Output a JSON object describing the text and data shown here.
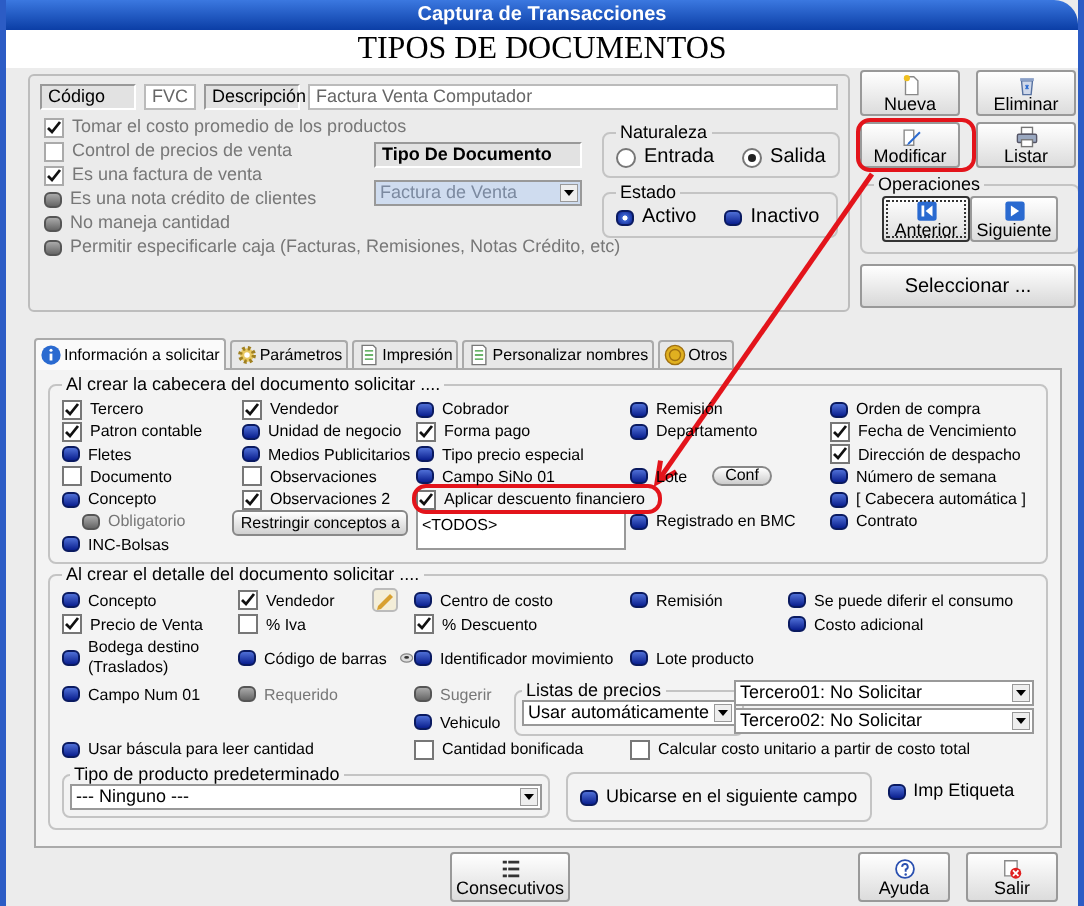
{
  "window": {
    "title": "Captura de Transacciones"
  },
  "heading": "TIPOS DE DOCUMENTOS",
  "general": {
    "code": {
      "label": "Código",
      "value": "FVC"
    },
    "description": {
      "label": "Descripción",
      "value": "Factura Venta Computador"
    },
    "options": [
      {
        "label": "Tomar el costo promedio de los productos",
        "kind": "checkbox",
        "checked": true,
        "disabled": true
      },
      {
        "label": "Control de precios de venta",
        "kind": "checkbox",
        "checked": false,
        "disabled": true
      },
      {
        "label": "Es una factura de venta",
        "kind": "checkbox",
        "checked": true,
        "disabled": true
      },
      {
        "label": "Es una nota crédito de clientes",
        "kind": "toggle",
        "disabled": true
      },
      {
        "label": "No maneja cantidad",
        "kind": "toggle",
        "disabled": true
      },
      {
        "label": "Permitir especificarle caja  (Facturas, Remisiones, Notas Crédito, etc)",
        "kind": "toggle",
        "disabled": true
      }
    ],
    "document_type": {
      "label": "Tipo De Documento",
      "value": "Factura de Venta",
      "disabled": true
    },
    "naturaleza": {
      "legend": "Naturaleza",
      "options": [
        {
          "label": "Entrada",
          "selected": false
        },
        {
          "label": "Salida",
          "selected": true
        }
      ]
    },
    "estado": {
      "legend": "Estado",
      "options": [
        {
          "label": "Activo",
          "selected": true
        },
        {
          "label": "Inactivo",
          "selected": false
        }
      ]
    }
  },
  "actions": [
    {
      "label": "Nueva",
      "highlighted": false
    },
    {
      "label": "Eliminar",
      "highlighted": false
    },
    {
      "label": "Modificar",
      "highlighted": true
    },
    {
      "label": "Listar",
      "highlighted": false
    }
  ],
  "operations": {
    "legend": "Operaciones",
    "buttons": [
      {
        "label": "Anterior",
        "focused": true
      },
      {
        "label": "Siguiente",
        "focused": false
      }
    ]
  },
  "select_button": "Seleccionar ...",
  "tabs": [
    {
      "label": "Información a solicitar",
      "selected": true
    },
    {
      "label": "Parámetros",
      "selected": false
    },
    {
      "label": "Impresión",
      "selected": false
    },
    {
      "label": "Personalizar nombres",
      "selected": false
    },
    {
      "label": "Otros",
      "selected": false
    }
  ],
  "header_section": {
    "legend": "Al crear la cabecera del documento solicitar ....",
    "rows": [
      [
        {
          "label": "Tercero",
          "kind": "checkbox",
          "checked": true,
          "disabled": false,
          "highlighted": false
        },
        {
          "label": "Vendedor",
          "kind": "checkbox",
          "checked": true,
          "disabled": false,
          "highlighted": false
        },
        {
          "label": "Cobrador",
          "kind": "toggle",
          "disabled": false,
          "highlighted": false
        },
        {
          "label": "Remisión",
          "kind": "toggle",
          "disabled": false,
          "highlighted": false
        },
        {
          "label": "Orden de compra",
          "kind": "toggle",
          "disabled": false,
          "highlighted": false
        }
      ],
      [
        {
          "label": "Patron contable",
          "kind": "checkbox",
          "checked": true,
          "disabled": false,
          "highlighted": false
        },
        {
          "label": "Unidad de negocio",
          "kind": "toggle",
          "disabled": false,
          "highlighted": false
        },
        {
          "label": "Forma pago",
          "kind": "checkbox",
          "checked": true,
          "disabled": false,
          "highlighted": false
        },
        {
          "label": "Departamento",
          "kind": "toggle",
          "disabled": false,
          "highlighted": false
        },
        {
          "label": "Fecha de Vencimiento",
          "kind": "checkbox",
          "checked": true,
          "disabled": false,
          "highlighted": false
        }
      ],
      [
        {
          "label": "Fletes",
          "kind": "toggle",
          "disabled": false,
          "highlighted": false
        },
        {
          "label": "Medios Publicitarios",
          "kind": "toggle",
          "disabled": false,
          "highlighted": false
        },
        {
          "label": "Tipo precio especial",
          "kind": "toggle",
          "disabled": false,
          "highlighted": false
        },
        "",
        {
          "label": "Dirección de despacho",
          "kind": "checkbox",
          "checked": true,
          "disabled": false,
          "highlighted": false
        }
      ],
      [
        {
          "label": "Documento",
          "kind": "checkbox",
          "checked": false,
          "disabled": false,
          "highlighted": false
        },
        {
          "label": "Observaciones",
          "kind": "checkbox",
          "checked": false,
          "disabled": false,
          "highlighted": false
        },
        {
          "label": "Campo SiNo 01",
          "kind": "toggle",
          "disabled": false,
          "highlighted": false
        },
        {
          "label": "Lote",
          "kind": "toggle",
          "disabled": false,
          "highlighted": false,
          "button": "Conf"
        },
        {
          "label": "Número de semana",
          "kind": "toggle",
          "disabled": false,
          "highlighted": false
        }
      ],
      [
        {
          "label": "Concepto",
          "kind": "toggle",
          "disabled": false,
          "highlighted": false
        },
        {
          "label": "Observaciones 2",
          "kind": "checkbox",
          "checked": true,
          "disabled": false,
          "highlighted": false
        },
        {
          "label": "Aplicar descuento financiero",
          "kind": "checkbox",
          "checked": true,
          "disabled": false,
          "highlighted": true
        },
        "",
        {
          "label": "[ Cabecera automática ]",
          "kind": "toggle",
          "disabled": false,
          "highlighted": false
        }
      ],
      [
        {
          "label": "Obligatorio",
          "kind": "toggle",
          "disabled": true,
          "highlighted": false
        },
        {
          "kind": "button",
          "label": "Restringir conceptos a"
        },
        {
          "kind": "field",
          "value": "<TODOS>"
        },
        {
          "label": "Registrado en BMC",
          "kind": "toggle",
          "disabled": false,
          "highlighted": false
        },
        {
          "label": "Contrato",
          "kind": "toggle",
          "disabled": false,
          "highlighted": false
        }
      ],
      [
        {
          "label": "INC-Bolsas",
          "kind": "toggle",
          "disabled": false,
          "highlighted": false
        }
      ]
    ]
  },
  "detail_section": {
    "legend": "Al crear  el detalle del documento solicitar ....",
    "options": [
      {
        "label": "Concepto",
        "kind": "toggle",
        "disabled": false
      },
      {
        "label": "Vendedor",
        "kind": "checkbox",
        "checked": true,
        "disabled": false
      },
      {
        "label": "Centro de costo",
        "kind": "toggle",
        "disabled": false
      },
      {
        "label": "Remisión",
        "kind": "toggle",
        "disabled": false
      },
      {
        "label": "Se puede diferir el consumo",
        "kind": "toggle",
        "disabled": false
      },
      {
        "label": "Precio de Venta",
        "kind": "checkbox",
        "checked": true,
        "disabled": false
      },
      {
        "label": "% Iva",
        "kind": "checkbox",
        "checked": false,
        "disabled": false
      },
      {
        "label": "% Descuento",
        "kind": "checkbox",
        "checked": true,
        "disabled": false
      },
      {
        "label": "Costo adicional",
        "kind": "toggle",
        "disabled": false
      },
      {
        "label": "Bodega destino (Traslados)",
        "kind": "toggle",
        "disabled": false
      },
      {
        "label": "Código de barras",
        "kind": "toggle",
        "disabled": false
      },
      {
        "label": "Identificador movimiento",
        "kind": "toggle",
        "disabled": false
      },
      {
        "label": "Lote producto",
        "kind": "toggle",
        "disabled": false
      },
      {
        "label": "Campo Num 01",
        "kind": "toggle",
        "disabled": false
      },
      {
        "label": "Requerido",
        "kind": "toggle",
        "disabled": true
      },
      {
        "label": "Sugerir",
        "kind": "toggle",
        "disabled": true
      },
      {
        "label": "Vehiculo",
        "kind": "toggle",
        "disabled": false
      },
      {
        "label": "Usar báscula para leer cantidad",
        "kind": "toggle",
        "disabled": false
      },
      {
        "label": "Cantidad bonificada",
        "kind": "checkbox",
        "checked": false,
        "disabled": false
      },
      {
        "label": "Calcular costo unitario a partir de costo total",
        "kind": "checkbox",
        "checked": false,
        "disabled": false
      }
    ],
    "price_lists": {
      "legend": "Listas de precios",
      "value": "Usar automáticamente"
    },
    "third_parties": [
      "Tercero01: No Solicitar",
      "Tercero02: No Solicitar"
    ],
    "product_type": {
      "legend": "Tipo de producto predeterminado",
      "value": "--- Ninguno ---"
    },
    "next_field": {
      "label": "Ubicarse en el siguiente campo",
      "kind": "toggle",
      "disabled": false
    },
    "print_label": {
      "label": "Imp Etiqueta",
      "kind": "toggle",
      "disabled": false
    }
  },
  "footer_buttons": [
    {
      "label": "Consecutivos"
    },
    {
      "label": "Ayuda"
    },
    {
      "label": "Salir"
    }
  ]
}
